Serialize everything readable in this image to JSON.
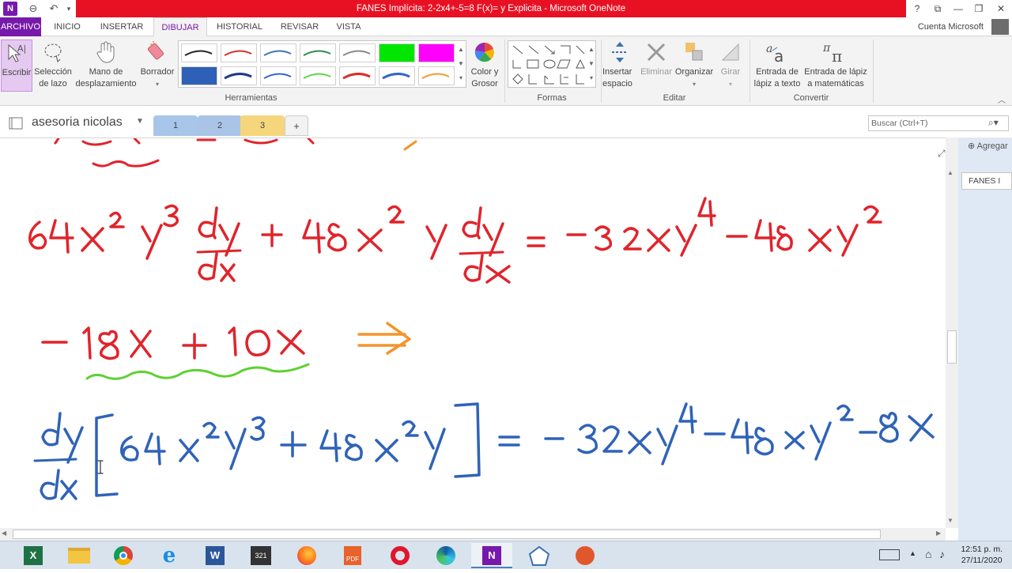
{
  "window": {
    "title": "FANES Implícita: 2-2x4+-5=8     F(x)= y Explicita -  Microsoft OneNote",
    "controls": [
      "?",
      "⧉",
      "—",
      "❐",
      "✕"
    ]
  },
  "tabs": {
    "file": "ARCHIVO",
    "items": [
      "INICIO",
      "INSERTAR",
      "DIBUJAR",
      "HISTORIAL",
      "REVISAR",
      "VISTA"
    ],
    "active": "DIBUJAR",
    "account": "Cuenta Microsoft"
  },
  "ribbon": {
    "tools": {
      "write": "Escribir",
      "lasso": "Selección de lazo",
      "pan": "Mano de desplazamiento",
      "eraser": "Borrador",
      "group": "Herramientas"
    },
    "color": "Color y Grosor",
    "shapes_group": "Formas",
    "edit": {
      "insert_space": "Insertar espacio",
      "delete": "Eliminar",
      "arrange": "Organizar",
      "rotate": "Girar",
      "group": "Editar"
    },
    "convert": {
      "ink_to_text": "Entrada de lápiz a texto",
      "ink_to_math": "Entrada de lápiz a matemáticas",
      "group": "Convertir"
    },
    "pen_colors": [
      "#222222",
      "#d9302c",
      "#3f73b8",
      "#2f8a4d",
      "#888888",
      "#00e600",
      "#ff00ff",
      "#2f60b8",
      "#1f3c86",
      "#3266c7",
      "#5ed64a",
      "#d9302c",
      "#3266c7",
      "#f29a2e"
    ]
  },
  "notebook": {
    "name": "asesoria nicolas",
    "sections": [
      "1",
      "2",
      "3"
    ],
    "add_section": "+",
    "search_placeholder": "Buscar (Ctrl+T)"
  },
  "pages": {
    "add": "Agregar",
    "current": "FANES I"
  },
  "ink": {
    "red": "#e0242b",
    "orange": "#f2952a",
    "green": "#5ed133",
    "blue": "#2f63b8"
  },
  "taskbar": {
    "time": "12:51 p. m.",
    "date": "27/11/2020"
  }
}
